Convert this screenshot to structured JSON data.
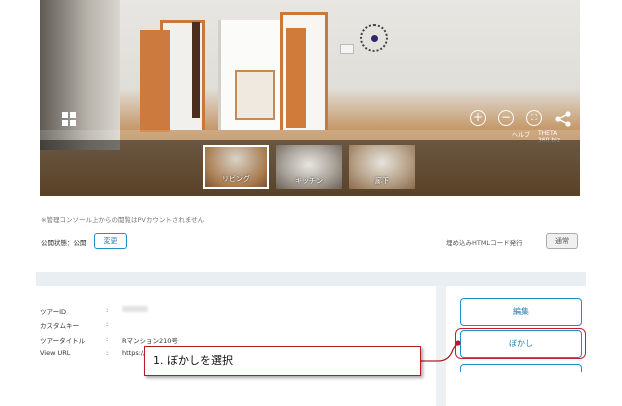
{
  "viewer": {
    "help_label": "ヘルプ",
    "theta_label": "THETA 360.biz",
    "controls": [
      "zoom-in-icon",
      "zoom-out-icon",
      "fullscreen-icon",
      "share-icon",
      "grid-menu-icon"
    ],
    "thumbnails": [
      {
        "label": "リビング",
        "active": true
      },
      {
        "label": "キッチン",
        "active": false
      },
      {
        "label": "廊下",
        "active": false
      }
    ]
  },
  "note": "※管理コンソール上からの閲覧はPVカウントされません",
  "status": {
    "label": "公開状態：公開",
    "change_button": "変更"
  },
  "embed": {
    "label": "埋め込みHTMLコード発行",
    "button": "通常"
  },
  "details": {
    "rows": [
      {
        "label": "ツアーID",
        "colon": ":",
        "value": ""
      },
      {
        "label": "カスタムキー",
        "colon": ":",
        "value": ""
      },
      {
        "label": "ツアータイトル",
        "colon": ":",
        "value": "Rマンション210号"
      },
      {
        "label": "View URL",
        "colon": ":",
        "value": "https://"
      }
    ]
  },
  "actions": {
    "edit": "編集",
    "blur": "ぼかし"
  },
  "callout": {
    "text": "1. ぼかしを選択",
    "color": "#b31d27"
  }
}
